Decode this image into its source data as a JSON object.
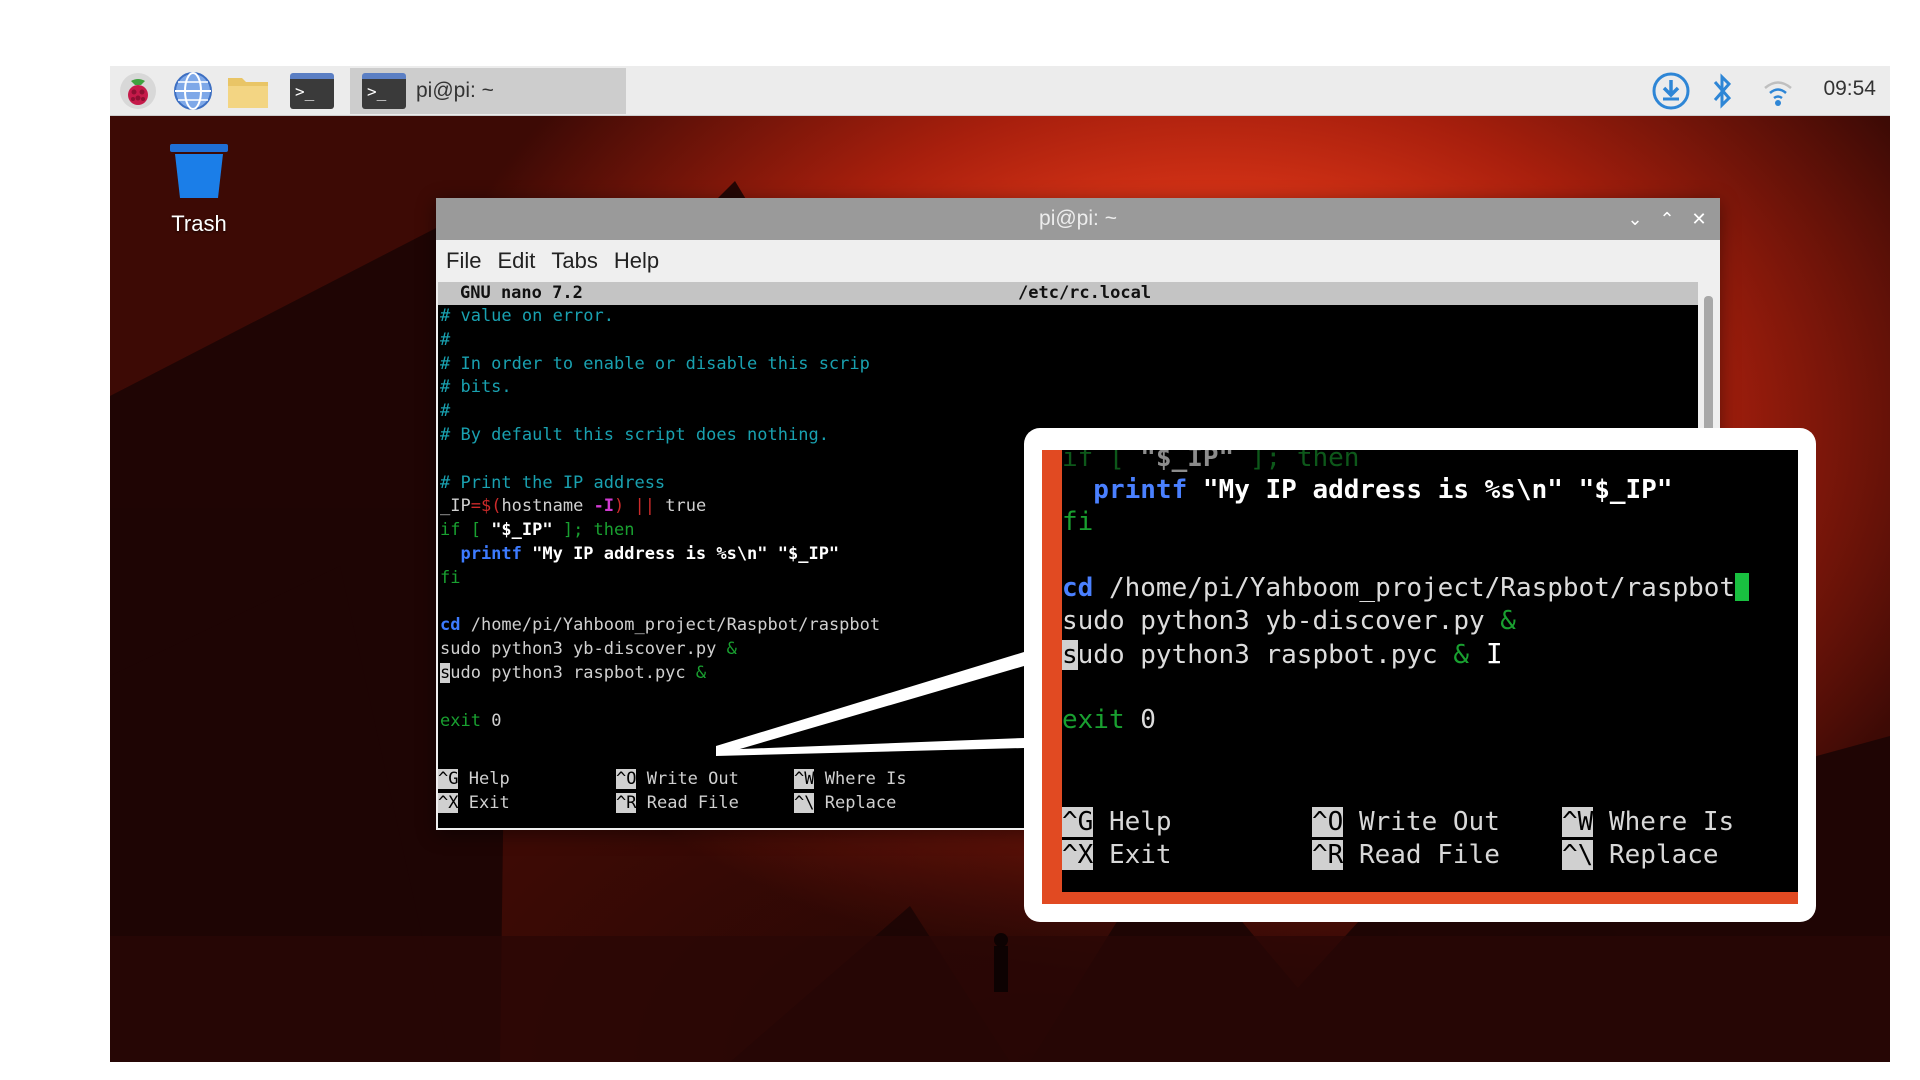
{
  "taskbar": {
    "task_label": "pi@pi: ~",
    "clock": "09:54",
    "icons": [
      "raspberry-menu-icon",
      "web-browser-icon",
      "file-manager-icon",
      "terminal-icon",
      "download-icon",
      "bluetooth-icon",
      "wifi-icon"
    ]
  },
  "desktop": {
    "trash_label": "Trash"
  },
  "window": {
    "title": "pi@pi: ~",
    "menu": [
      "File",
      "Edit",
      "Tabs",
      "Help"
    ],
    "controls": [
      "v",
      "^",
      "x"
    ]
  },
  "nano": {
    "version": "GNU nano 7.2",
    "filename": "/etc/rc.local",
    "lines": {
      "l1": "# value on error.",
      "l2": "#",
      "l3": "# In order to enable or disable this scrip",
      "l4": "# bits.",
      "l5": "#",
      "l6": "# By default this script does nothing.",
      "l8": "# Print the IP address",
      "l9a": "_IP",
      "l9b": "=$(",
      "l9c": "hostname ",
      "l9d": "-I",
      "l9e": ") || ",
      "l9f": "true",
      "l10a": "if [ ",
      "l10b": "\"$_IP\"",
      "l10c": " ]; then",
      "l11a": "  printf ",
      "l11b": "\"My IP address is %s\\n\" \"$_IP\"",
      "l12": "fi",
      "l14a": "cd",
      "l14b": " /home/pi/Yahboom_project/Raspbot/raspbot",
      "l15a": "sudo python3 yb-discover.py ",
      "l15b": "&",
      "l16a": "s",
      "l16b": "udo python3 raspbot.pyc ",
      "l16c": "&",
      "l18a": "exit",
      "l18b": " 0"
    },
    "shortcuts": [
      {
        "key": "^G",
        "label": "Help"
      },
      {
        "key": "^O",
        "label": "Write Out"
      },
      {
        "key": "^W",
        "label": "Where Is"
      },
      {
        "key": "^X",
        "label": "Exit"
      },
      {
        "key": "^R",
        "label": "Read File"
      },
      {
        "key": "^\\",
        "label": "Replace"
      }
    ]
  },
  "zoom": {
    "z0a": "if [ ",
    "z0b": "\"$_IP\"",
    "z0c": " ]; then",
    "z1a": "  printf ",
    "z1b": "\"My IP address is %s\\n\" \"$_IP\"",
    "z2": "fi",
    "z3a": "cd",
    "z3b": " /home/pi/Yahboom_project/Raspbot/raspbot",
    "z4a": "sudo python3 yb-discover.py ",
    "z4b": "&",
    "z5a": "s",
    "z5b": "udo python3 raspbot.pyc ",
    "z5c": "&",
    "z6a": "exit",
    "z6b": " 0"
  },
  "colors": {
    "wallpaper_red": "#e93b1a",
    "nano_comment": "#19a1b0",
    "nano_keyword": "#3d7bff",
    "nano_green": "#19a030",
    "cursor_green": "#19c040"
  }
}
